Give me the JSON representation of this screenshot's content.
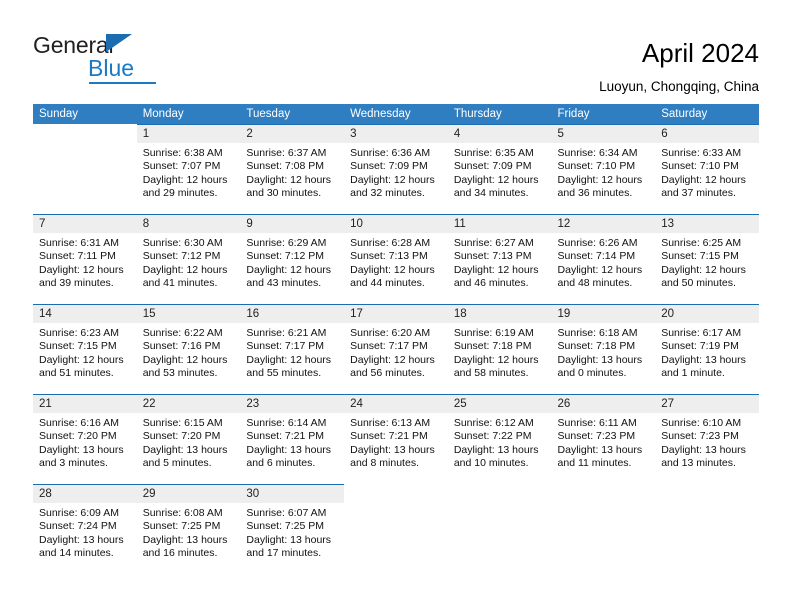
{
  "brand": {
    "name_top": "General",
    "name_bottom": "Blue",
    "triangle_color": "#1b6cb0",
    "blue_color": "#1b7ac4"
  },
  "header": {
    "title": "April 2024",
    "location": "Luoyun, Chongqing, China"
  },
  "theme": {
    "header_blue": "#2f7ec1",
    "cell_border_blue": "#1b6cb0",
    "daynum_band": "#eeeeee"
  },
  "calendar": {
    "weekdays": [
      "Sunday",
      "Monday",
      "Tuesday",
      "Wednesday",
      "Thursday",
      "Friday",
      "Saturday"
    ],
    "weeks": [
      [
        {
          "day": "",
          "empty": true,
          "sunrise": "",
          "sunset": "",
          "daylight1": "",
          "daylight2": ""
        },
        {
          "day": "1",
          "sunrise": "Sunrise: 6:38 AM",
          "sunset": "Sunset: 7:07 PM",
          "daylight1": "Daylight: 12 hours",
          "daylight2": "and 29 minutes."
        },
        {
          "day": "2",
          "sunrise": "Sunrise: 6:37 AM",
          "sunset": "Sunset: 7:08 PM",
          "daylight1": "Daylight: 12 hours",
          "daylight2": "and 30 minutes."
        },
        {
          "day": "3",
          "sunrise": "Sunrise: 6:36 AM",
          "sunset": "Sunset: 7:09 PM",
          "daylight1": "Daylight: 12 hours",
          "daylight2": "and 32 minutes."
        },
        {
          "day": "4",
          "sunrise": "Sunrise: 6:35 AM",
          "sunset": "Sunset: 7:09 PM",
          "daylight1": "Daylight: 12 hours",
          "daylight2": "and 34 minutes."
        },
        {
          "day": "5",
          "sunrise": "Sunrise: 6:34 AM",
          "sunset": "Sunset: 7:10 PM",
          "daylight1": "Daylight: 12 hours",
          "daylight2": "and 36 minutes."
        },
        {
          "day": "6",
          "sunrise": "Sunrise: 6:33 AM",
          "sunset": "Sunset: 7:10 PM",
          "daylight1": "Daylight: 12 hours",
          "daylight2": "and 37 minutes."
        }
      ],
      [
        {
          "day": "7",
          "sunrise": "Sunrise: 6:31 AM",
          "sunset": "Sunset: 7:11 PM",
          "daylight1": "Daylight: 12 hours",
          "daylight2": "and 39 minutes."
        },
        {
          "day": "8",
          "sunrise": "Sunrise: 6:30 AM",
          "sunset": "Sunset: 7:12 PM",
          "daylight1": "Daylight: 12 hours",
          "daylight2": "and 41 minutes."
        },
        {
          "day": "9",
          "sunrise": "Sunrise: 6:29 AM",
          "sunset": "Sunset: 7:12 PM",
          "daylight1": "Daylight: 12 hours",
          "daylight2": "and 43 minutes."
        },
        {
          "day": "10",
          "sunrise": "Sunrise: 6:28 AM",
          "sunset": "Sunset: 7:13 PM",
          "daylight1": "Daylight: 12 hours",
          "daylight2": "and 44 minutes."
        },
        {
          "day": "11",
          "sunrise": "Sunrise: 6:27 AM",
          "sunset": "Sunset: 7:13 PM",
          "daylight1": "Daylight: 12 hours",
          "daylight2": "and 46 minutes."
        },
        {
          "day": "12",
          "sunrise": "Sunrise: 6:26 AM",
          "sunset": "Sunset: 7:14 PM",
          "daylight1": "Daylight: 12 hours",
          "daylight2": "and 48 minutes."
        },
        {
          "day": "13",
          "sunrise": "Sunrise: 6:25 AM",
          "sunset": "Sunset: 7:15 PM",
          "daylight1": "Daylight: 12 hours",
          "daylight2": "and 50 minutes."
        }
      ],
      [
        {
          "day": "14",
          "sunrise": "Sunrise: 6:23 AM",
          "sunset": "Sunset: 7:15 PM",
          "daylight1": "Daylight: 12 hours",
          "daylight2": "and 51 minutes."
        },
        {
          "day": "15",
          "sunrise": "Sunrise: 6:22 AM",
          "sunset": "Sunset: 7:16 PM",
          "daylight1": "Daylight: 12 hours",
          "daylight2": "and 53 minutes."
        },
        {
          "day": "16",
          "sunrise": "Sunrise: 6:21 AM",
          "sunset": "Sunset: 7:17 PM",
          "daylight1": "Daylight: 12 hours",
          "daylight2": "and 55 minutes."
        },
        {
          "day": "17",
          "sunrise": "Sunrise: 6:20 AM",
          "sunset": "Sunset: 7:17 PM",
          "daylight1": "Daylight: 12 hours",
          "daylight2": "and 56 minutes."
        },
        {
          "day": "18",
          "sunrise": "Sunrise: 6:19 AM",
          "sunset": "Sunset: 7:18 PM",
          "daylight1": "Daylight: 12 hours",
          "daylight2": "and 58 minutes."
        },
        {
          "day": "19",
          "sunrise": "Sunrise: 6:18 AM",
          "sunset": "Sunset: 7:18 PM",
          "daylight1": "Daylight: 13 hours",
          "daylight2": "and 0 minutes."
        },
        {
          "day": "20",
          "sunrise": "Sunrise: 6:17 AM",
          "sunset": "Sunset: 7:19 PM",
          "daylight1": "Daylight: 13 hours",
          "daylight2": "and 1 minute."
        }
      ],
      [
        {
          "day": "21",
          "sunrise": "Sunrise: 6:16 AM",
          "sunset": "Sunset: 7:20 PM",
          "daylight1": "Daylight: 13 hours",
          "daylight2": "and 3 minutes."
        },
        {
          "day": "22",
          "sunrise": "Sunrise: 6:15 AM",
          "sunset": "Sunset: 7:20 PM",
          "daylight1": "Daylight: 13 hours",
          "daylight2": "and 5 minutes."
        },
        {
          "day": "23",
          "sunrise": "Sunrise: 6:14 AM",
          "sunset": "Sunset: 7:21 PM",
          "daylight1": "Daylight: 13 hours",
          "daylight2": "and 6 minutes."
        },
        {
          "day": "24",
          "sunrise": "Sunrise: 6:13 AM",
          "sunset": "Sunset: 7:21 PM",
          "daylight1": "Daylight: 13 hours",
          "daylight2": "and 8 minutes."
        },
        {
          "day": "25",
          "sunrise": "Sunrise: 6:12 AM",
          "sunset": "Sunset: 7:22 PM",
          "daylight1": "Daylight: 13 hours",
          "daylight2": "and 10 minutes."
        },
        {
          "day": "26",
          "sunrise": "Sunrise: 6:11 AM",
          "sunset": "Sunset: 7:23 PM",
          "daylight1": "Daylight: 13 hours",
          "daylight2": "and 11 minutes."
        },
        {
          "day": "27",
          "sunrise": "Sunrise: 6:10 AM",
          "sunset": "Sunset: 7:23 PM",
          "daylight1": "Daylight: 13 hours",
          "daylight2": "and 13 minutes."
        }
      ],
      [
        {
          "day": "28",
          "sunrise": "Sunrise: 6:09 AM",
          "sunset": "Sunset: 7:24 PM",
          "daylight1": "Daylight: 13 hours",
          "daylight2": "and 14 minutes."
        },
        {
          "day": "29",
          "sunrise": "Sunrise: 6:08 AM",
          "sunset": "Sunset: 7:25 PM",
          "daylight1": "Daylight: 13 hours",
          "daylight2": "and 16 minutes."
        },
        {
          "day": "30",
          "sunrise": "Sunrise: 6:07 AM",
          "sunset": "Sunset: 7:25 PM",
          "daylight1": "Daylight: 13 hours",
          "daylight2": "and 17 minutes."
        },
        {
          "day": "",
          "empty": true,
          "sunrise": "",
          "sunset": "",
          "daylight1": "",
          "daylight2": ""
        },
        {
          "day": "",
          "empty": true,
          "sunrise": "",
          "sunset": "",
          "daylight1": "",
          "daylight2": ""
        },
        {
          "day": "",
          "empty": true,
          "sunrise": "",
          "sunset": "",
          "daylight1": "",
          "daylight2": ""
        },
        {
          "day": "",
          "empty": true,
          "sunrise": "",
          "sunset": "",
          "daylight1": "",
          "daylight2": ""
        }
      ]
    ]
  }
}
